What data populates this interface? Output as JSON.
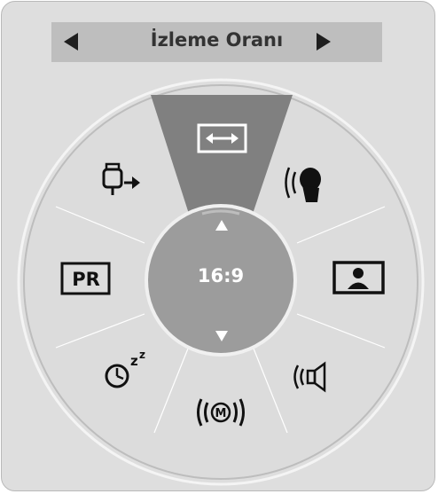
{
  "header": {
    "title": "İzleme Oranı",
    "prev_icon": "left-arrow-icon",
    "next_icon": "right-arrow-icon"
  },
  "dial": {
    "selected_value": "16:9",
    "up_icon": "up-arrow-icon",
    "down_icon": "down-arrow-icon",
    "items": [
      {
        "name": "aspect-ratio",
        "icon": "aspect-ratio-icon",
        "selected": true
      },
      {
        "name": "voice",
        "icon": "speaking-head-icon",
        "selected": false
      },
      {
        "name": "picture",
        "icon": "picture-mode-icon",
        "selected": false
      },
      {
        "name": "sound",
        "icon": "speaker-icon",
        "selected": false
      },
      {
        "name": "audio-mode",
        "icon": "m-sound-icon",
        "selected": false
      },
      {
        "name": "sleep-timer",
        "icon": "sleep-timer-icon",
        "selected": false
      },
      {
        "name": "pr-list",
        "icon": "pr-icon",
        "pr_text": "PR",
        "selected": false
      },
      {
        "name": "input",
        "icon": "input-source-icon",
        "selected": false
      }
    ]
  },
  "colors": {
    "panel": "#dedede",
    "title_bar": "#bebebe",
    "highlight": "#808080",
    "center": "#9c9c9c",
    "icon": "#111111"
  }
}
